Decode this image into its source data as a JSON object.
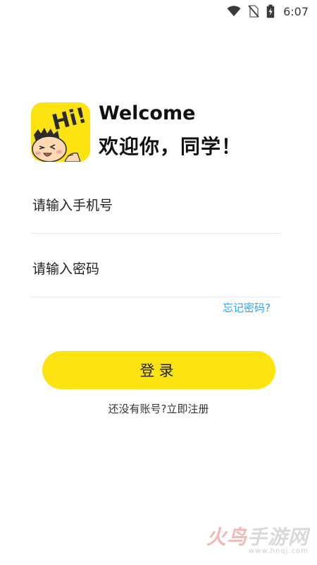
{
  "status_bar": {
    "time": "6:07",
    "icons": [
      "wifi-icon",
      "no-sim-icon",
      "battery-charging-icon"
    ]
  },
  "header": {
    "logo_text": "Hi!",
    "welcome": "Welcome",
    "greeting": "欢迎你，同学！"
  },
  "form": {
    "phone_placeholder": "请输入手机号",
    "phone_value": "",
    "password_placeholder": "请输入密码",
    "password_value": "",
    "forgot_password": "忘记密码?",
    "login_label": "登录",
    "register_prompt": "还没有账号?立即注册"
  },
  "watermark": {
    "accent": "火鸟",
    "main": "手游网",
    "url": "www.hnqj.com"
  },
  "colors": {
    "accent_yellow": "#fde310",
    "link_blue": "#2aa3f0"
  }
}
